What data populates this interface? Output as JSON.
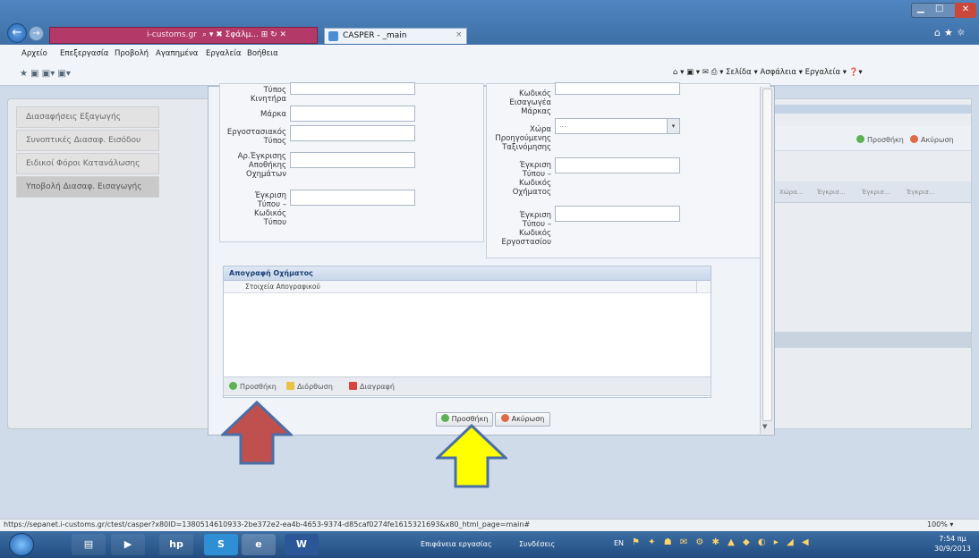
{
  "browser": {
    "address_text": "i-customs.gr",
    "address_icons": "⌕ ▾ ✖ Σφάλμ... ⊞ ↻ ✕",
    "tab_label": "CASPER - _main",
    "tab_close": "×",
    "window_controls": {
      "minimize": "▁",
      "maximize": "□",
      "close": "✕"
    },
    "fav_icons": "⌂★☼"
  },
  "menubar": {
    "items": [
      "Αρχείο",
      "Επεξεργασία",
      "Προβολή",
      "Αγαπημένα",
      "Εργαλεία",
      "Βοήθεια"
    ],
    "command_bar": "⌂ ▾  ▣ ▾ ✉  ⎙ ▾  Σελίδα ▾  Ασφάλεια ▾  Εργαλεία ▾  ❓▾"
  },
  "sidebar": {
    "items": [
      "Διασαφήσεις Εξαγωγής",
      "Συνοπτικές Διασαφ. Εισόδου",
      "Ειδικοί Φόροι Κατανάλωσης",
      "Υποβολή Διασαφ. Εισαγωγής"
    ]
  },
  "right_panel": {
    "add_label": "Προσθήκη",
    "cancel_label": "Ακύρωση",
    "columns": [
      "Χώρα...",
      "Έγκρισ...",
      "Έγκρισ...",
      "Έγκρισ..."
    ]
  },
  "dialog": {
    "left_fields": [
      {
        "label": "Τύπος\nΚινητήρα"
      },
      {
        "label": "Μάρκα"
      },
      {
        "label": "Εργοστασιακός\nΤύπος"
      },
      {
        "label": "Αρ.Έγκρισης\nΑποθήκης\nΟχημάτων"
      },
      {
        "label": "Έγκριση\nΤύπου –\nΚωδικός\nΤύπου"
      }
    ],
    "right_fields": [
      {
        "label": "Κωδικός\nΕισαγωγέα\nΜάρκας"
      },
      {
        "label": "Χώρα\nΠροηγούμενης\nΤαξινόμησης",
        "value": "...",
        "arrow": "▾"
      },
      {
        "label": "Έγκριση\nΤύπου –\nΚωδικός\nΟχήματος"
      },
      {
        "label": "Έγκριση\nΤύπου –\nΚωδικός\nΕργοστασίου"
      }
    ],
    "inventory": {
      "title": "Απογραφή Οχήματος",
      "column": "Στοιχεία Απογραφικού",
      "toolbar": {
        "add": "Προσθήκη",
        "edit": "Διόρθωση",
        "delete": "Διαγραφή"
      }
    },
    "buttons": {
      "add": "Προσθήκη",
      "cancel": "Ακύρωση"
    }
  },
  "status": {
    "url": "https://sepanet.i-customs.gr/ctest/casper?x80ID=1380514610933-2be372e2-ea4b-4653-9374-d85caf0274fe1615321693&x80_html_page=main#",
    "zoom": "100%  ▾"
  },
  "taskbar": {
    "apps": [
      "▤",
      "▶",
      "hp",
      "S",
      "e",
      "W"
    ],
    "desktop": "Επιφάνεια εργασίας",
    "connections": "Συνδέσεις",
    "lang": "EN",
    "tray": "⚑ ✦ ☗ ✉ ⚙ ✱ ▲ ◆ ◐ ▸ ◢ ◀",
    "time": "7:54 πμ",
    "date": "30/9/2013"
  },
  "colors": {
    "arrow_red": "#c0504d",
    "arrow_yellow": "#ffff00",
    "arrow_outline": "#4a6fa5"
  }
}
